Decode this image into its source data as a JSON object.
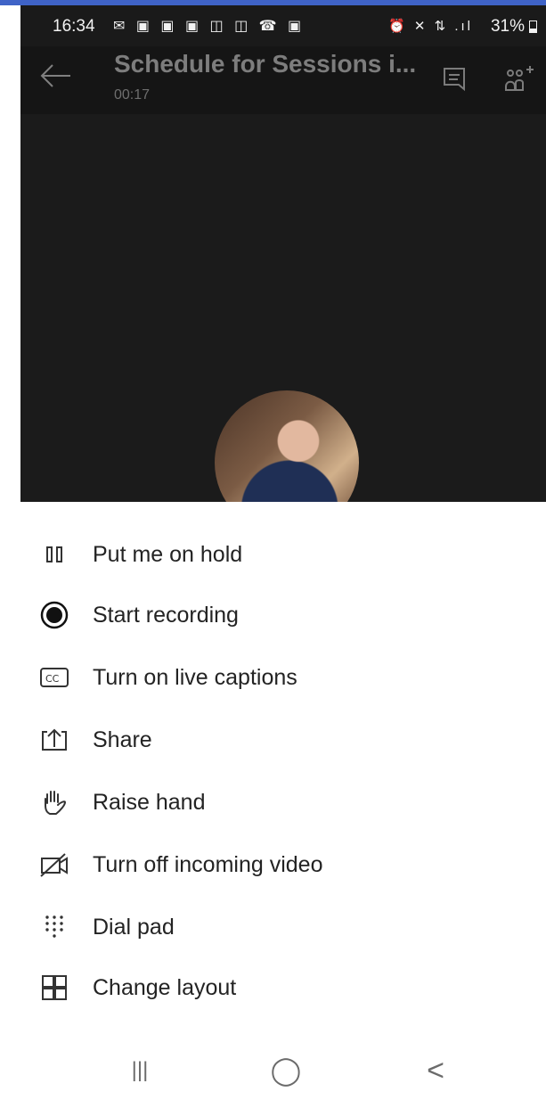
{
  "status_bar": {
    "time": "16:34",
    "left_icons": "✉ ▣ ▣ ▣ ◫ ◫ ☎ ▣",
    "right_icons": "⏰ ✕ ⇅ .ıl",
    "battery_percent": "31%",
    "battery_level": 0.31
  },
  "call": {
    "title": "Schedule for Sessions i...",
    "timer": "00:17"
  },
  "options": [
    {
      "label": "Put me on hold",
      "icon": "pause-icon"
    },
    {
      "label": "Start recording",
      "icon": "record-icon"
    },
    {
      "label": "Turn on live captions",
      "icon": "captions-icon"
    },
    {
      "label": "Share",
      "icon": "share-icon"
    },
    {
      "label": "Raise hand",
      "icon": "raise-hand-icon"
    },
    {
      "label": "Turn off incoming video",
      "icon": "video-off-icon"
    },
    {
      "label": "Dial pad",
      "icon": "dial-pad-icon"
    },
    {
      "label": "Change layout",
      "icon": "layout-icon"
    }
  ],
  "nav": {
    "recents_symbol": "|||",
    "home_symbol": "◯",
    "back_symbol": "<"
  }
}
